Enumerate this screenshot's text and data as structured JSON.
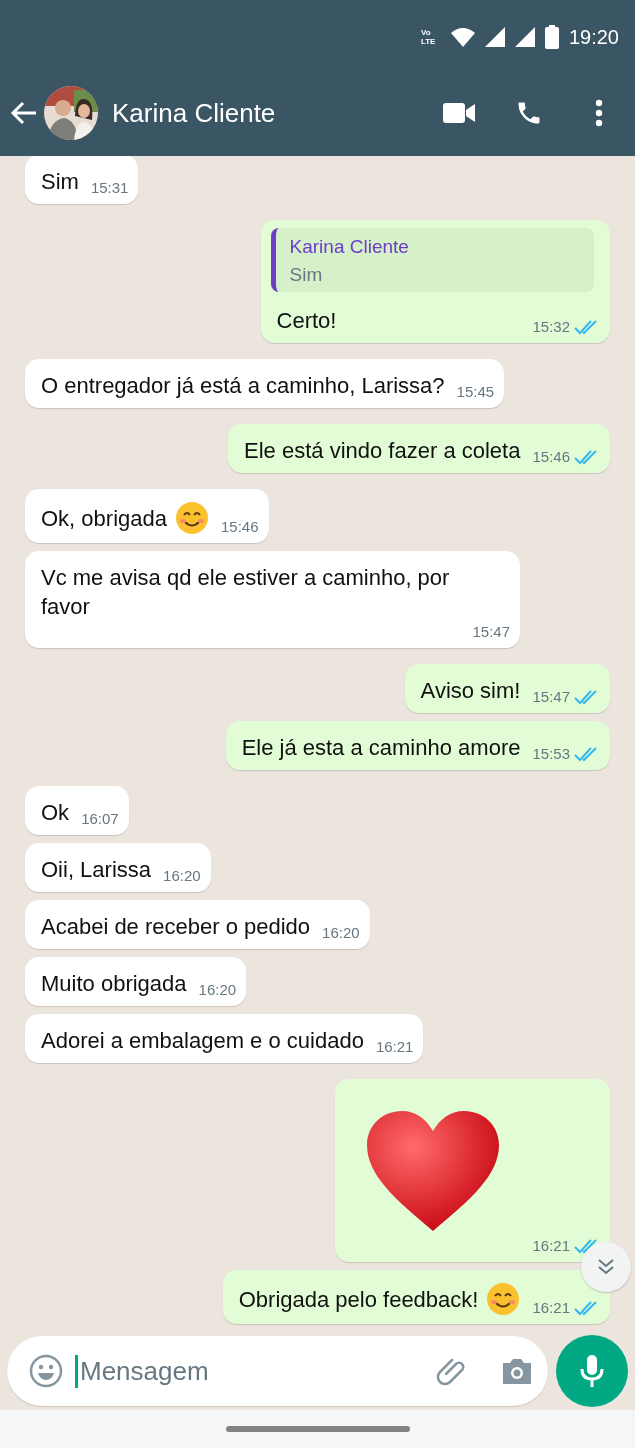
{
  "status_bar": {
    "time": "19:20",
    "network": "Vo LTE"
  },
  "header": {
    "contact_name": "Karina Cliente"
  },
  "messages": [
    {
      "kind": "in",
      "text": "Sim",
      "time": "15:31"
    },
    {
      "kind": "out",
      "quote": {
        "author": "Karina Cliente",
        "text": "Sim"
      },
      "text": "Certo!",
      "time": "15:32",
      "read": true
    },
    {
      "kind": "in",
      "text": "O entregador já está a caminho, Larissa?",
      "time": "15:45"
    },
    {
      "kind": "out",
      "text": "Ele está vindo fazer a coleta",
      "time": "15:46",
      "read": true
    },
    {
      "kind": "in",
      "text": "Ok, obrigada",
      "emoji": true,
      "time": "15:46"
    },
    {
      "kind": "in",
      "text": "Vc me avisa qd ele estiver a caminho, por favor",
      "time": "15:47"
    },
    {
      "kind": "out",
      "text": "Aviso sim!",
      "time": "15:47",
      "read": true
    },
    {
      "kind": "out",
      "text": "Ele já esta a caminho amore",
      "time": "15:53",
      "read": true
    },
    {
      "kind": "in",
      "text": "Ok",
      "time": "16:07"
    },
    {
      "kind": "in",
      "text": "Oii, Larissa",
      "time": "16:20"
    },
    {
      "kind": "in",
      "text": "Acabei de receber o pedido",
      "time": "16:20"
    },
    {
      "kind": "in",
      "text": "Muito obrigada",
      "time": "16:20"
    },
    {
      "kind": "in",
      "text": "Adorei a embalagem e o cuidado",
      "time": "16:21"
    },
    {
      "kind": "sticker",
      "time": "16:21",
      "read": true
    },
    {
      "kind": "out",
      "text": "Obrigada pelo feedback!",
      "emoji": true,
      "time": "16:21",
      "read": true
    }
  ],
  "composer": {
    "placeholder": "Mensagem"
  }
}
